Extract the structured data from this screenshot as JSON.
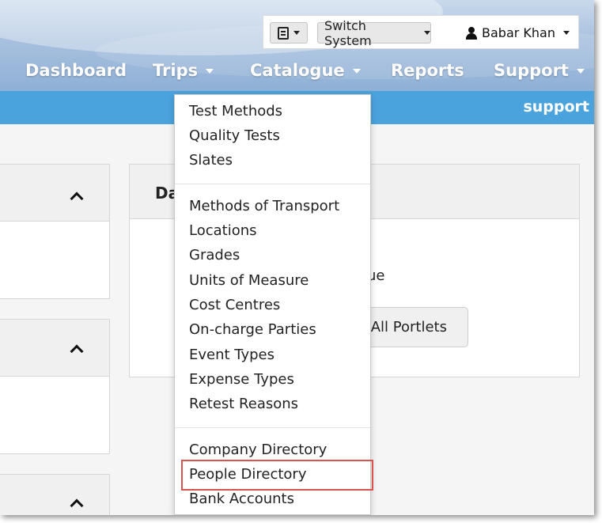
{
  "topbar": {
    "icon_button": "book-icon",
    "switch_system_label": "Switch System",
    "user_name": "Babar Khan"
  },
  "nav": {
    "items": [
      {
        "label": "Dashboard",
        "has_caret": false
      },
      {
        "label": "Trips",
        "has_caret": true
      },
      {
        "label": "Catalogue",
        "has_caret": true
      },
      {
        "label": "Reports",
        "has_caret": false
      },
      {
        "label": "Support",
        "has_caret": true
      }
    ]
  },
  "subbar": {
    "link": "support"
  },
  "dashboard_card": {
    "title": "Da",
    "text": "ue",
    "button": "l All Portlets"
  },
  "dropdown": {
    "group1": [
      "Test Methods",
      "Quality Tests",
      "Slates"
    ],
    "group2": [
      "Methods of Transport",
      "Locations",
      "Grades",
      "Units of Measure",
      "Cost Centres",
      "On-charge Parties",
      "Event Types",
      "Expense Types",
      "Retest Reasons"
    ],
    "group3": [
      "Company Directory",
      "People Directory",
      "Bank Accounts"
    ],
    "highlighted": "People Directory"
  },
  "colors": {
    "subbar": "#4aa3dd",
    "highlight": "#d9534f",
    "nav_text": "#ffffff"
  }
}
